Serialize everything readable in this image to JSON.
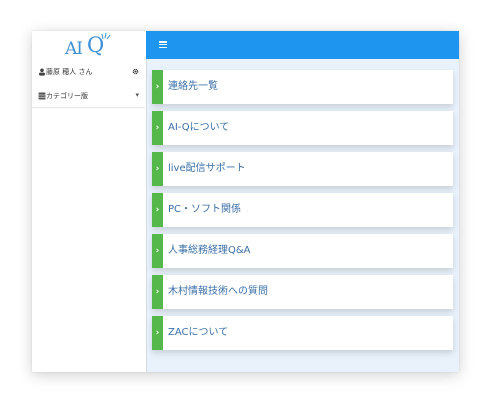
{
  "logo": {
    "ai": "AI",
    "q": "Q"
  },
  "sidebar": {
    "user_name": "藤原 穂人 さん",
    "user_action_icon": "gear-icon",
    "category_label": "カテゴリー版",
    "category_caret": "▾"
  },
  "topbar": {
    "menu_icon": "hamburger-icon"
  },
  "cards": [
    {
      "arrow": "›",
      "title": "連絡先一覧"
    },
    {
      "arrow": "›",
      "title": "AI-Qについて"
    },
    {
      "arrow": "›",
      "title": "live配信サポート"
    },
    {
      "arrow": "›",
      "title": "PC・ソフト関係"
    },
    {
      "arrow": "›",
      "title": "人事総務経理Q&A"
    },
    {
      "arrow": "›",
      "title": "木村情報技術への質問"
    },
    {
      "arrow": "›",
      "title": "ZACについて"
    }
  ],
  "colors": {
    "topbar": "#1e95ee",
    "card_strip": "#55b84a",
    "card_text": "#3a6fa8",
    "logo": "#3c8fd6"
  }
}
